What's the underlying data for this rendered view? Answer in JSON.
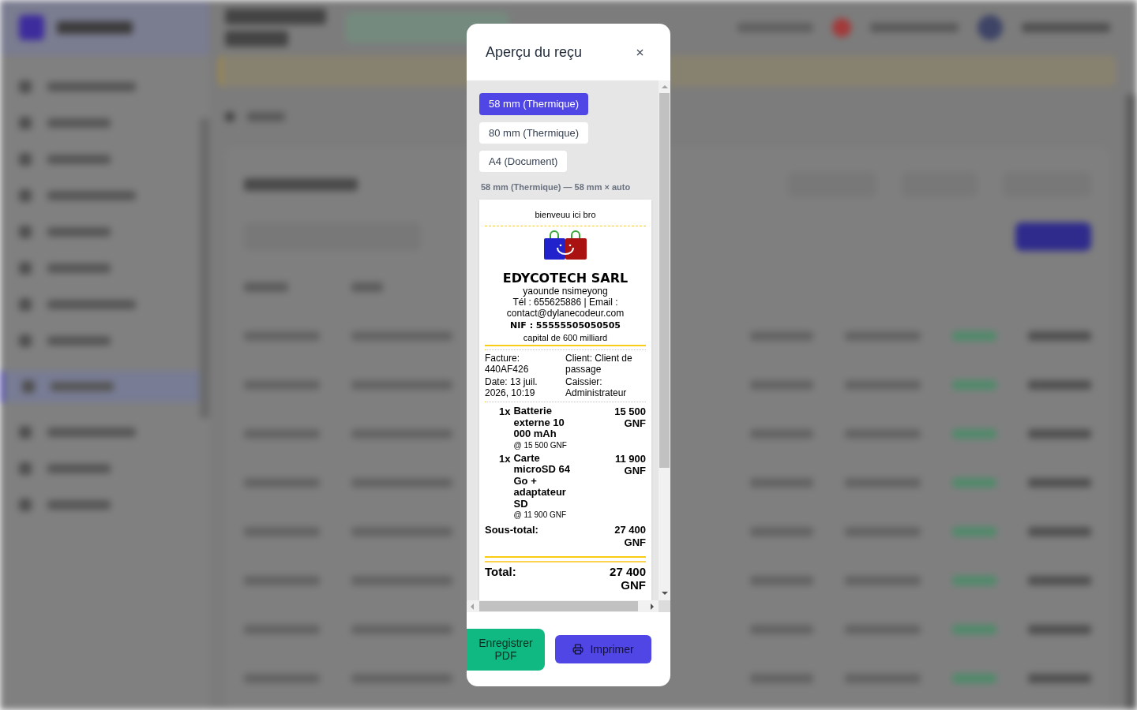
{
  "dialog": {
    "title": "Aperçu du reçu",
    "formats": [
      {
        "label": "58 mm (Thermique)",
        "selected": true
      },
      {
        "label": "80 mm (Thermique)",
        "selected": false
      },
      {
        "label": "A4 (Document)",
        "selected": false
      }
    ],
    "format_caption": "58 mm (Thermique) — 58 mm × auto",
    "receipt": {
      "greeting": "bienveuu ici bro",
      "company_name": "EDYCOTECH SARL",
      "address": "yaounde nsimeyong",
      "contact": "Tél : 655625886 | Email : contact@dylanecodeur.com",
      "tax_id": "NIF : 55555505050505",
      "capital": "capital de 600 milliard",
      "info": [
        "Facture: 440AF426",
        "Client: Client de passage",
        "Date: 13 juil. 2026, 10:19",
        "Caissier: Administrateur"
      ],
      "items": [
        {
          "quantity": "1x",
          "name": "Batterie externe 10 000 mAh",
          "unit_price": "@ 15 500 GNF",
          "amount": "15 500 GNF"
        },
        {
          "quantity": "1x",
          "name": "Carte microSD 64 Go + adaptateur SD",
          "unit_price": "@ 11 900 GNF",
          "amount": "11 900 GNF"
        }
      ],
      "subtotal_label": "Sous-total:",
      "subtotal": "27 400 GNF",
      "total_label": "Total:",
      "total": "27 400 GNF"
    },
    "actions": [
      {
        "label": "Enregistrer PDF",
        "kind": "save"
      },
      {
        "label": "Imprimer",
        "kind": "print"
      }
    ]
  }
}
